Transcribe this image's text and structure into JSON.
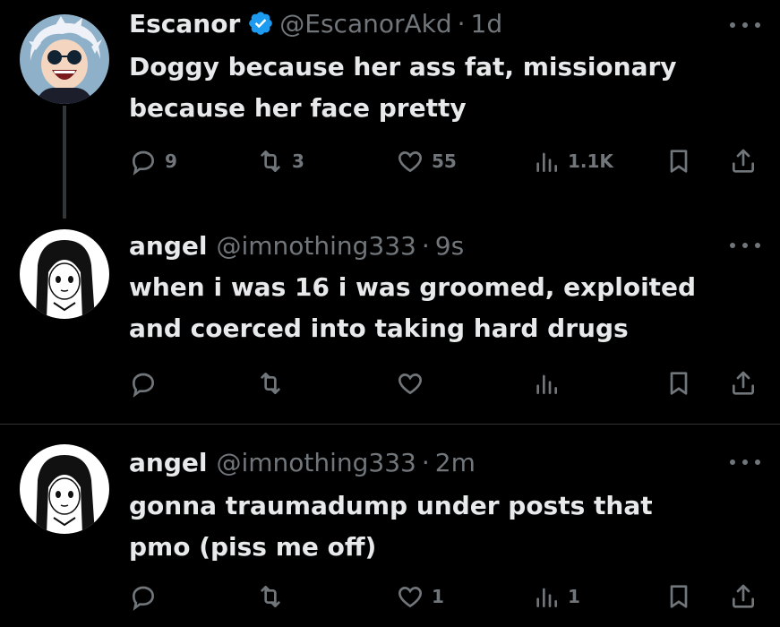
{
  "tweets": [
    {
      "name": "Escanor",
      "verified": true,
      "handle": "@EscanorAkd",
      "time": "1d",
      "text_lines": [
        "Doggy because her ass fat, missionary",
        "because her face pretty"
      ],
      "replies": "9",
      "retweets": "3",
      "likes": "55",
      "views": "1.1K"
    },
    {
      "name": "angel",
      "handle": "@imnothing333",
      "time": "9s",
      "text_lines": [
        "when i was 16 i was groomed, exploited",
        "and coerced into taking hard drugs"
      ],
      "replies": "",
      "retweets": "",
      "likes": "",
      "views": ""
    },
    {
      "name": "angel",
      "handle": "@imnothing333",
      "time": "2m",
      "text_lines": [
        "gonna traumadump under posts that",
        "pmo (piss me off)"
      ],
      "replies": "",
      "retweets": "",
      "likes": "1",
      "views": "1"
    }
  ],
  "icons": {
    "reply": "speech-bubble-icon",
    "retweet": "retweet-arrows-icon",
    "like": "heart-icon",
    "views": "bar-chart-icon",
    "bookmark": "bookmark-icon",
    "share": "share-upload-icon",
    "verified": "verified-badge-icon",
    "more": "more-dots-icon"
  },
  "colors": {
    "background": "#000000",
    "text": "#e7e9ea",
    "secondary": "#71767b",
    "verified": "#1d9bf0"
  }
}
